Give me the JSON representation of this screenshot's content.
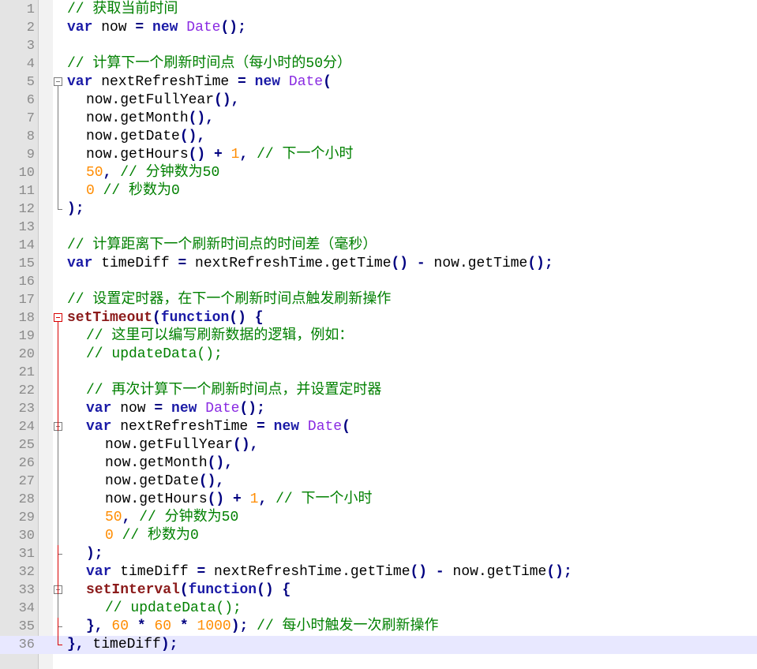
{
  "editor": {
    "colors": {
      "keyword": "#1a1aa6",
      "function_call": "#8b1a1a",
      "class": "#8a2be2",
      "number": "#ff8c00",
      "operator": "#000080",
      "comment": "#008000",
      "current_line": "#e8e8ff"
    },
    "current_line": 36,
    "fold_markers": [
      {
        "line": 5,
        "type": "start"
      },
      {
        "line": 12,
        "type": "end"
      },
      {
        "line": 18,
        "type": "start",
        "active": true
      },
      {
        "line": 24,
        "type": "start"
      },
      {
        "line": 31,
        "type": "end"
      },
      {
        "line": 33,
        "type": "start"
      },
      {
        "line": 35,
        "type": "end"
      },
      {
        "line": 36,
        "type": "end",
        "active": true
      }
    ],
    "lines": [
      {
        "n": "1",
        "indent": 0,
        "tokens": [
          [
            "cm",
            "// 获取当前时间"
          ]
        ]
      },
      {
        "n": "2",
        "indent": 0,
        "tokens": [
          [
            "kw",
            "var"
          ],
          [
            "pl",
            " now "
          ],
          [
            "op",
            "="
          ],
          [
            "pl",
            " "
          ],
          [
            "kw",
            "new"
          ],
          [
            "pl",
            " "
          ],
          [
            "cls",
            "Date"
          ],
          [
            "op",
            "();"
          ]
        ]
      },
      {
        "n": "3",
        "indent": 0,
        "tokens": []
      },
      {
        "n": "4",
        "indent": 0,
        "tokens": [
          [
            "cm",
            "// 计算下一个刷新时间点（每小时的50分）"
          ]
        ]
      },
      {
        "n": "5",
        "indent": 0,
        "tokens": [
          [
            "kw",
            "var"
          ],
          [
            "pl",
            " nextRefreshTime "
          ],
          [
            "op",
            "="
          ],
          [
            "pl",
            " "
          ],
          [
            "kw",
            "new"
          ],
          [
            "pl",
            " "
          ],
          [
            "cls",
            "Date"
          ],
          [
            "op",
            "("
          ]
        ]
      },
      {
        "n": "6",
        "indent": 1,
        "tokens": [
          [
            "pl",
            "now.getFullYear"
          ],
          [
            "op",
            "(),"
          ]
        ]
      },
      {
        "n": "7",
        "indent": 1,
        "tokens": [
          [
            "pl",
            "now.getMonth"
          ],
          [
            "op",
            "(),"
          ]
        ]
      },
      {
        "n": "8",
        "indent": 1,
        "tokens": [
          [
            "pl",
            "now.getDate"
          ],
          [
            "op",
            "(),"
          ]
        ]
      },
      {
        "n": "9",
        "indent": 1,
        "tokens": [
          [
            "pl",
            "now.getHours"
          ],
          [
            "op",
            "()"
          ],
          [
            "pl",
            " "
          ],
          [
            "op",
            "+"
          ],
          [
            "pl",
            " "
          ],
          [
            "num",
            "1"
          ],
          [
            "op",
            ","
          ],
          [
            "pl",
            " "
          ],
          [
            "cm",
            "// 下一个小时"
          ]
        ]
      },
      {
        "n": "10",
        "indent": 1,
        "tokens": [
          [
            "num",
            "50"
          ],
          [
            "op",
            ","
          ],
          [
            "pl",
            " "
          ],
          [
            "cm",
            "// 分钟数为50"
          ]
        ]
      },
      {
        "n": "11",
        "indent": 1,
        "tokens": [
          [
            "num",
            "0"
          ],
          [
            "pl",
            " "
          ],
          [
            "cm",
            "// 秒数为0"
          ]
        ]
      },
      {
        "n": "12",
        "indent": 0,
        "tokens": [
          [
            "op",
            ");"
          ]
        ]
      },
      {
        "n": "13",
        "indent": 0,
        "tokens": []
      },
      {
        "n": "14",
        "indent": 0,
        "tokens": [
          [
            "cm",
            "// 计算距离下一个刷新时间点的时间差（毫秒）"
          ]
        ]
      },
      {
        "n": "15",
        "indent": 0,
        "tokens": [
          [
            "kw",
            "var"
          ],
          [
            "pl",
            " timeDiff "
          ],
          [
            "op",
            "="
          ],
          [
            "pl",
            " nextRefreshTime.getTime"
          ],
          [
            "op",
            "()"
          ],
          [
            "pl",
            " "
          ],
          [
            "op",
            "-"
          ],
          [
            "pl",
            " now.getTime"
          ],
          [
            "op",
            "();"
          ]
        ]
      },
      {
        "n": "16",
        "indent": 0,
        "tokens": []
      },
      {
        "n": "17",
        "indent": 0,
        "tokens": [
          [
            "cm",
            "// 设置定时器，在下一个刷新时间点触发刷新操作"
          ]
        ]
      },
      {
        "n": "18",
        "indent": 0,
        "tokens": [
          [
            "fn",
            "setTimeout"
          ],
          [
            "op",
            "("
          ],
          [
            "kw",
            "function"
          ],
          [
            "op",
            "()"
          ],
          [
            "pl",
            " "
          ],
          [
            "op",
            "{"
          ]
        ]
      },
      {
        "n": "19",
        "indent": 1,
        "tokens": [
          [
            "cm",
            "// 这里可以编写刷新数据的逻辑，例如："
          ]
        ]
      },
      {
        "n": "20",
        "indent": 1,
        "tokens": [
          [
            "cm",
            "// updateData();"
          ]
        ]
      },
      {
        "n": "21",
        "indent": 0,
        "tokens": []
      },
      {
        "n": "22",
        "indent": 1,
        "tokens": [
          [
            "cm",
            "// 再次计算下一个刷新时间点，并设置定时器"
          ]
        ]
      },
      {
        "n": "23",
        "indent": 1,
        "tokens": [
          [
            "kw",
            "var"
          ],
          [
            "pl",
            " now "
          ],
          [
            "op",
            "="
          ],
          [
            "pl",
            " "
          ],
          [
            "kw",
            "new"
          ],
          [
            "pl",
            " "
          ],
          [
            "cls",
            "Date"
          ],
          [
            "op",
            "();"
          ]
        ]
      },
      {
        "n": "24",
        "indent": 1,
        "tokens": [
          [
            "kw",
            "var"
          ],
          [
            "pl",
            " nextRefreshTime "
          ],
          [
            "op",
            "="
          ],
          [
            "pl",
            " "
          ],
          [
            "kw",
            "new"
          ],
          [
            "pl",
            " "
          ],
          [
            "cls",
            "Date"
          ],
          [
            "op",
            "("
          ]
        ]
      },
      {
        "n": "25",
        "indent": 2,
        "tokens": [
          [
            "pl",
            "now.getFullYear"
          ],
          [
            "op",
            "(),"
          ]
        ]
      },
      {
        "n": "26",
        "indent": 2,
        "tokens": [
          [
            "pl",
            "now.getMonth"
          ],
          [
            "op",
            "(),"
          ]
        ]
      },
      {
        "n": "27",
        "indent": 2,
        "tokens": [
          [
            "pl",
            "now.getDate"
          ],
          [
            "op",
            "(),"
          ]
        ]
      },
      {
        "n": "28",
        "indent": 2,
        "tokens": [
          [
            "pl",
            "now.getHours"
          ],
          [
            "op",
            "()"
          ],
          [
            "pl",
            " "
          ],
          [
            "op",
            "+"
          ],
          [
            "pl",
            " "
          ],
          [
            "num",
            "1"
          ],
          [
            "op",
            ","
          ],
          [
            "pl",
            " "
          ],
          [
            "cm",
            "// 下一个小时"
          ]
        ]
      },
      {
        "n": "29",
        "indent": 2,
        "tokens": [
          [
            "num",
            "50"
          ],
          [
            "op",
            ","
          ],
          [
            "pl",
            " "
          ],
          [
            "cm",
            "// 分钟数为50"
          ]
        ]
      },
      {
        "n": "30",
        "indent": 2,
        "tokens": [
          [
            "num",
            "0"
          ],
          [
            "pl",
            " "
          ],
          [
            "cm",
            "// 秒数为0"
          ]
        ]
      },
      {
        "n": "31",
        "indent": 1,
        "tokens": [
          [
            "op",
            ");"
          ]
        ]
      },
      {
        "n": "32",
        "indent": 1,
        "tokens": [
          [
            "kw",
            "var"
          ],
          [
            "pl",
            " timeDiff "
          ],
          [
            "op",
            "="
          ],
          [
            "pl",
            " nextRefreshTime.getTime"
          ],
          [
            "op",
            "()"
          ],
          [
            "pl",
            " "
          ],
          [
            "op",
            "-"
          ],
          [
            "pl",
            " now.getTime"
          ],
          [
            "op",
            "();"
          ]
        ]
      },
      {
        "n": "33",
        "indent": 1,
        "tokens": [
          [
            "fn",
            "setInterval"
          ],
          [
            "op",
            "("
          ],
          [
            "kw",
            "function"
          ],
          [
            "op",
            "()"
          ],
          [
            "pl",
            " "
          ],
          [
            "op",
            "{"
          ]
        ]
      },
      {
        "n": "34",
        "indent": 2,
        "tokens": [
          [
            "cm",
            "// updateData();"
          ]
        ]
      },
      {
        "n": "35",
        "indent": 1,
        "tokens": [
          [
            "op",
            "},"
          ],
          [
            "pl",
            " "
          ],
          [
            "num",
            "60"
          ],
          [
            "pl",
            " "
          ],
          [
            "op",
            "*"
          ],
          [
            "pl",
            " "
          ],
          [
            "num",
            "60"
          ],
          [
            "pl",
            " "
          ],
          [
            "op",
            "*"
          ],
          [
            "pl",
            " "
          ],
          [
            "num",
            "1000"
          ],
          [
            "op",
            ");"
          ],
          [
            "pl",
            " "
          ],
          [
            "cm",
            "// 每小时触发一次刷新操作"
          ]
        ]
      },
      {
        "n": "36",
        "indent": 0,
        "tokens": [
          [
            "op",
            "},"
          ],
          [
            "pl",
            " timeDiff"
          ],
          [
            "op",
            ");"
          ]
        ]
      }
    ]
  }
}
